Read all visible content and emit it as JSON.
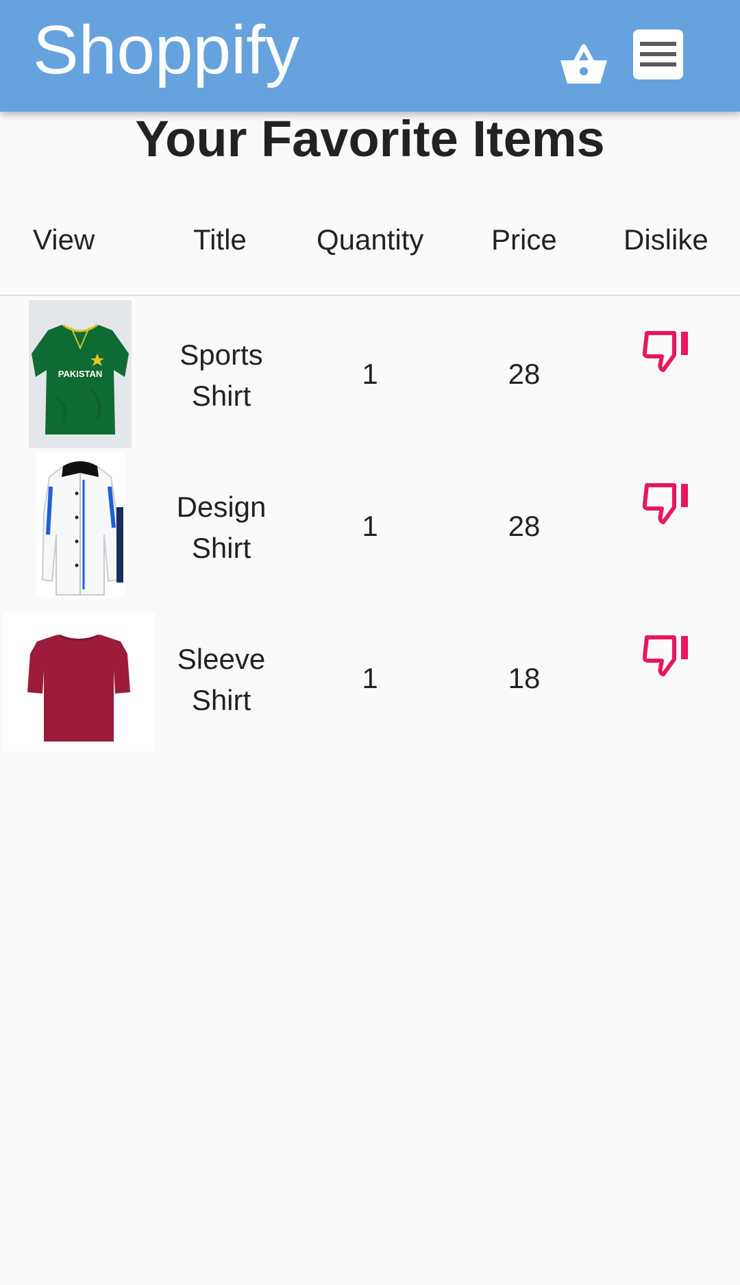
{
  "app": {
    "title": "Shoppify",
    "brand_color": "#66a3de",
    "icons": [
      "shopping-basket-icon",
      "menu-icon"
    ]
  },
  "page": {
    "heading": "Your Favorite Items"
  },
  "table": {
    "columns": [
      "View",
      "Title",
      "Quantity",
      "Price",
      "Dislike"
    ],
    "rows": [
      {
        "image_icon": "green-sports-jersey",
        "title_line1": "Sports",
        "title_line2": "Shirt",
        "quantity": "1",
        "price": "28",
        "action_icon": "thumb-down-icon"
      },
      {
        "image_icon": "white-design-shirt",
        "title_line1": "Design",
        "title_line2": "Shirt",
        "quantity": "1",
        "price": "28",
        "action_icon": "thumb-down-icon"
      },
      {
        "image_icon": "maroon-tshirt",
        "title_line1": "Sleeve",
        "title_line2": "Shirt",
        "quantity": "1",
        "price": "18",
        "action_icon": "thumb-down-icon"
      }
    ],
    "dislike_color": "#e8175d"
  }
}
